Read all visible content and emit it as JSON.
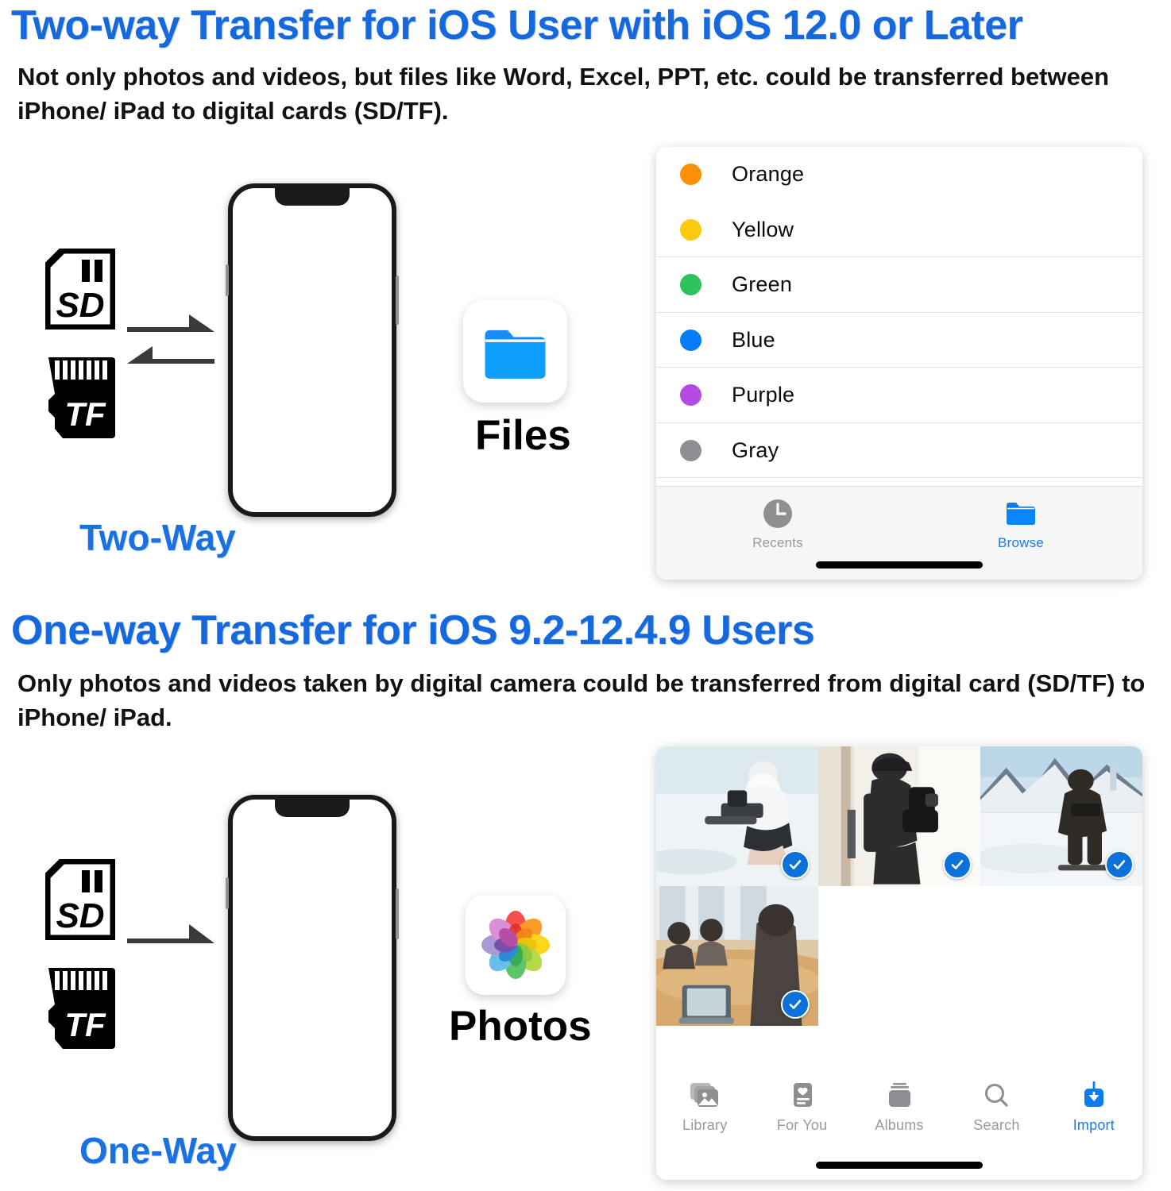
{
  "sections": [
    {
      "heading": "Two-way Transfer for iOS User with iOS 12.0 or Later",
      "description": "Not only photos and videos, but files like Word, Excel, PPT, etc. could be transferred between iPhone/ iPad to digital cards (SD/TF).",
      "way_label": "Two-Way",
      "card_labels": {
        "sd": "SD",
        "tf": "TF"
      },
      "arrow_direction": "bidirectional",
      "app": {
        "name": "Files",
        "icon": "blue-folder-icon"
      }
    },
    {
      "heading": "One-way Transfer for iOS 9.2-12.4.9 Users",
      "description": "Only photos and videos taken by digital camera could be transferred from digital card (SD/TF) to iPhone/ iPad.",
      "way_label": "One-Way",
      "card_labels": {
        "sd": "SD",
        "tf": "TF"
      },
      "arrow_direction": "right",
      "app": {
        "name": "Photos",
        "icon": "photos-pinwheel-icon"
      }
    }
  ],
  "files_app": {
    "rows": [
      {
        "label": "Orange",
        "color": "#f79007"
      },
      {
        "label": "Yellow",
        "color": "#fbc90d"
      },
      {
        "label": "Green",
        "color": "#2fc25b"
      },
      {
        "label": "Blue",
        "color": "#067df7"
      },
      {
        "label": "Purple",
        "color": "#b martin"
      },
      {
        "label": "Gray",
        "color": "#8e8e93"
      }
    ],
    "tabs": [
      {
        "label": "Recents",
        "icon": "clock-icon",
        "active": false
      },
      {
        "label": "Browse",
        "icon": "folder-icon",
        "active": true
      }
    ]
  },
  "photos_app": {
    "photos": [
      {
        "alt": "person-sitting-with-gimbal-camera-on-snow",
        "selected": true
      },
      {
        "alt": "person-holding-camera-rig-indoors",
        "selected": true
      },
      {
        "alt": "skier-with-camera-in-snowy-mountains",
        "selected": true
      },
      {
        "alt": "people-at-conference-table-with-laptop",
        "selected": true
      }
    ],
    "tabs": [
      {
        "label": "Library",
        "icon": "photo-stack-icon",
        "active": false
      },
      {
        "label": "For You",
        "icon": "for-you-card-icon",
        "active": false
      },
      {
        "label": "Albums",
        "icon": "albums-icon",
        "active": false
      },
      {
        "label": "Search",
        "icon": "search-icon",
        "active": false
      },
      {
        "label": "Import",
        "icon": "import-down-arrow-icon",
        "active": true
      }
    ]
  },
  "colors": {
    "heading_blue": "#1668dd",
    "accent_blue": "#1a7bea",
    "check_blue": "#0a72d8",
    "text_black": "#111111"
  }
}
